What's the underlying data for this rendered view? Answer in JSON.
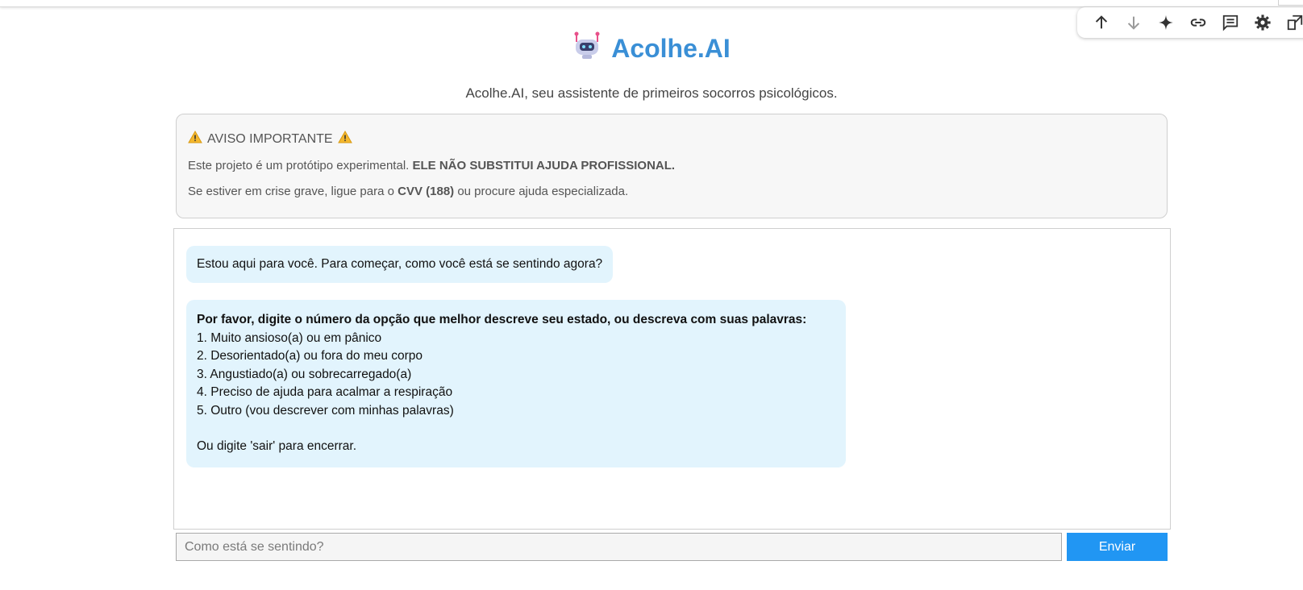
{
  "app": {
    "title": "Acolhe.AI",
    "subtitle": "Acolhe.AI, seu assistente de primeiros socorros psicológicos.",
    "logo_icon": "robot-icon"
  },
  "toolbar": {
    "items": [
      "arrow-up-icon",
      "arrow-down-icon",
      "sparkle-icon",
      "link-icon",
      "comment-icon",
      "gear-icon",
      "open-external-icon"
    ]
  },
  "notice": {
    "title": "AVISO IMPORTANTE",
    "warning_icon": "warning-icon",
    "line1_text": "Este projeto é um protótipo experimental. ",
    "line1_bold": "ELE NÃO SUBSTITUI AJUDA PROFISSIONAL.",
    "line2_text": "Se estiver em crise grave, ligue para o ",
    "line2_bold": "CVV (188)",
    "line2_end": " ou procure ajuda especializada."
  },
  "chat": {
    "messages": [
      {
        "text": "Estou aqui para você. Para começar, como você está se sentindo agora?"
      },
      {
        "lead": "Por favor, digite o número da opção que melhor descreve seu estado, ou descreva com suas palavras:",
        "options": [
          "1. Muito ansioso(a) ou em pânico",
          "2. Desorientado(a) ou fora do meu corpo",
          "3. Angustiado(a) ou sobrecarregado(a)",
          "4. Preciso de ajuda para acalmar a respiração",
          "5. Outro (vou descrever com minhas palavras)"
        ],
        "closing": "Ou digite 'sair' para encerrar."
      }
    ]
  },
  "input": {
    "placeholder": "Como está se sentindo?",
    "value": "",
    "send_label": "Enviar"
  },
  "colors": {
    "accent": "#3a8fd6",
    "button": "#2196f3",
    "bubble": "#e2f4fd",
    "notice_bg": "#f7f7f7"
  }
}
